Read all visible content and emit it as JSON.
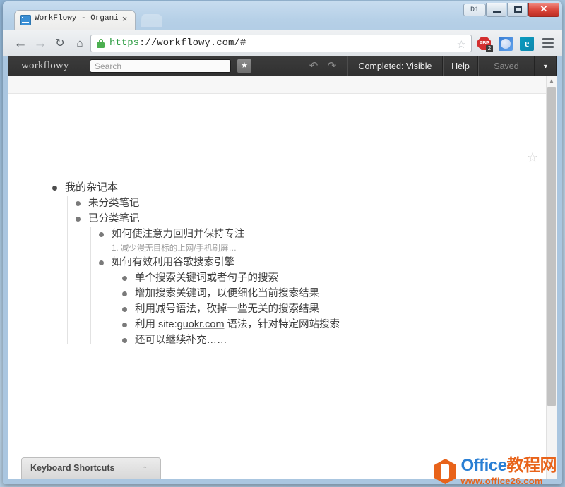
{
  "browser": {
    "tab": {
      "title": "WorkFlowy - Organize yo",
      "close_label": "×",
      "favicon_name": "list-favicon"
    },
    "window_controls": {
      "di_label": "Di",
      "minimize_label": "",
      "maximize_label": "",
      "close_label": "✕"
    },
    "nav": {
      "back": "←",
      "forward": "→",
      "reload": "↻",
      "home": "⌂"
    },
    "omnibox": {
      "scheme": "https",
      "rest": "://workflowy.com/#",
      "star": "☆"
    },
    "extensions": [
      {
        "name": "adblock-plus",
        "label": "ABP",
        "badge": "2"
      },
      {
        "name": "blue-circle-extension",
        "label": ""
      },
      {
        "name": "e-extension",
        "label": "e"
      }
    ],
    "menu": "hamburger-menu"
  },
  "workflowy": {
    "logo": "workflowy",
    "search_placeholder": "Search",
    "star_button": "★",
    "undo": "↶",
    "redo": "↷",
    "completed_button": "Completed: Visible",
    "help_button": "Help",
    "saved_button": "Saved",
    "dropdown_button": "▼",
    "page_star": "☆",
    "keyboard_shortcuts": {
      "label": "Keyboard Shortcuts",
      "arrow": "↑"
    },
    "scroll_up_arrow": "▲"
  },
  "outline": {
    "root": {
      "text": "我的杂记本",
      "children": [
        {
          "text": "未分类笔记"
        },
        {
          "text": "已分类笔记",
          "children": [
            {
              "text": "如何使注意力回归并保持专注",
              "note": "1. 减少漫无目标的上网/手机刷屏…"
            },
            {
              "text": "如何有效利用谷歌搜索引擎",
              "children": [
                {
                  "text": "单个搜索关键词或者句子的搜索"
                },
                {
                  "text": "增加搜索关键词，以便细化当前搜索结果"
                },
                {
                  "text": "利用减号语法，砍掉一些无关的搜索结果"
                },
                {
                  "text_before": "利用 site:",
                  "link": "guokr.com",
                  "text_after": " 语法，针对特定网站搜索"
                },
                {
                  "text": "还可以继续补充……"
                }
              ]
            }
          ]
        }
      ]
    }
  },
  "watermark": {
    "line1_en": "Office",
    "line1_cn": "教程网",
    "line2": "www.office26.com"
  },
  "colors": {
    "toolbar_bg": "#333333",
    "link": "#3d3d3d",
    "watermark_blue": "#2a7fd4",
    "watermark_orange": "#e8631a",
    "https_green": "#2f9e44"
  }
}
